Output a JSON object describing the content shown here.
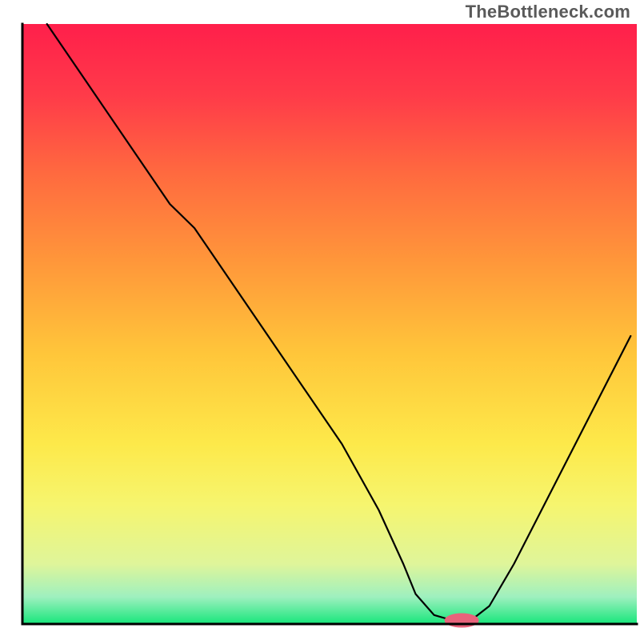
{
  "watermark": "TheBottleneck.com",
  "chart_data": {
    "type": "line",
    "title": "",
    "xlabel": "",
    "ylabel": "",
    "xlim": [
      0,
      100
    ],
    "ylim": [
      0,
      100
    ],
    "axes_visible": false,
    "grid": false,
    "background_gradient": {
      "type": "vertical",
      "stops": [
        {
          "pos": 0.0,
          "color": "#ff1f4b"
        },
        {
          "pos": 0.12,
          "color": "#ff3b49"
        },
        {
          "pos": 0.25,
          "color": "#ff6a3f"
        },
        {
          "pos": 0.4,
          "color": "#ff983a"
        },
        {
          "pos": 0.55,
          "color": "#ffc63a"
        },
        {
          "pos": 0.7,
          "color": "#fde94a"
        },
        {
          "pos": 0.8,
          "color": "#f6f56e"
        },
        {
          "pos": 0.9,
          "color": "#dff59a"
        },
        {
          "pos": 0.955,
          "color": "#9ef0bf"
        },
        {
          "pos": 1.0,
          "color": "#17e67b"
        }
      ]
    },
    "series": [
      {
        "name": "bottleneck-curve",
        "stroke": "#000000",
        "stroke_width": 2.2,
        "x": [
          4,
          10,
          18,
          24,
          28,
          34,
          40,
          46,
          52,
          58,
          62,
          64,
          67,
          70,
          73,
          76,
          80,
          85,
          90,
          95,
          99
        ],
        "y": [
          100,
          91,
          79,
          70,
          66,
          57,
          48,
          39,
          30,
          19,
          10,
          5,
          1.5,
          0.6,
          0.6,
          3,
          10,
          20,
          30,
          40,
          48
        ]
      }
    ],
    "marker": {
      "name": "optimal-point",
      "x": 71.5,
      "y": 0.6,
      "rx": 2.8,
      "ry": 1.2,
      "fill": "#e8637b"
    },
    "frame": {
      "left": true,
      "bottom": true,
      "right": false,
      "top": false,
      "stroke": "#000000",
      "stroke_width": 3
    }
  }
}
